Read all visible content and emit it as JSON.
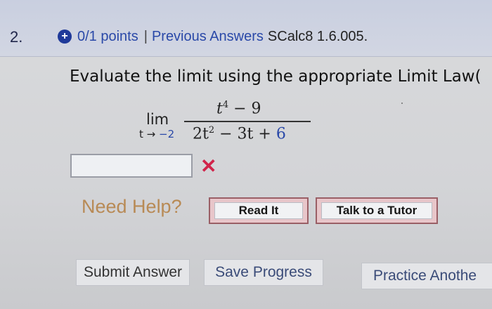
{
  "header": {
    "question_number": "2.",
    "points": "0/1 points",
    "separator": "|",
    "previous_answers": "Previous Answers",
    "problem_code": "SCalc8 1.6.005."
  },
  "question": {
    "instruction": "Evaluate the limit using the appropriate Limit Law(",
    "lim_label": "lim",
    "lim_variable": "t",
    "lim_arrow": "→",
    "lim_value": "−2",
    "numerator": {
      "var": "t",
      "exp": "4",
      "rest": " − 9"
    },
    "denominator": {
      "coef": "2t",
      "exp": "2",
      "middle": " − 3t + ",
      "const": "6"
    }
  },
  "answer": {
    "value": "",
    "status_icon": "x-mark-icon",
    "status_color": "#d1234a"
  },
  "help": {
    "label": "Need Help?",
    "read_it": "Read It",
    "talk_to_tutor": "Talk to a Tutor"
  },
  "actions": {
    "submit": "Submit Answer",
    "save": "Save Progress",
    "practice": "Practice Anothe"
  },
  "colors": {
    "link_blue": "#2a49a8",
    "help_orange": "#b88a55",
    "button_border": "#9a5f66"
  }
}
